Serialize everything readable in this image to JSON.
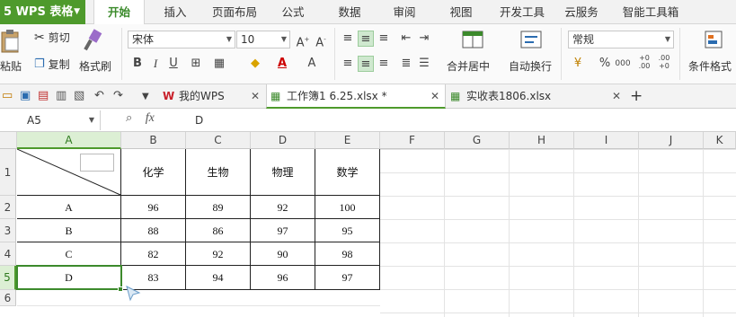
{
  "menubar": {
    "app_label": "5 WPS 表格",
    "tabs": [
      "开始",
      "插入",
      "页面布局",
      "公式",
      "数据",
      "审阅",
      "视图",
      "开发工具",
      "云服务",
      "智能工具箱"
    ],
    "active_tab": "开始"
  },
  "ribbon": {
    "paste_label": "粘贴",
    "cut_label": "剪切",
    "copy_label": "复制",
    "format_painter_label": "格式刷",
    "font_name": "宋体",
    "font_size": "10",
    "merge_center_label": "合并居中",
    "wrap_text_label": "自动换行",
    "number_format": "常规",
    "conditional_format_label": "条件格式",
    "percent_symbol": "%",
    "comma_symbol": "000"
  },
  "tabbar": {
    "tabs": [
      {
        "label": "我的WPS"
      },
      {
        "label": "工作簿1 6.25.xlsx *"
      },
      {
        "label": "实收表1806.xlsx"
      }
    ],
    "new_tab": "+"
  },
  "formulabar": {
    "name_box": "A5",
    "fx": "fx",
    "value": "D"
  },
  "grid": {
    "columns": [
      "A",
      "B",
      "C",
      "D",
      "E",
      "F",
      "G",
      "H",
      "I",
      "J",
      "K"
    ],
    "rows": [
      "1",
      "2",
      "3",
      "4",
      "5",
      "6"
    ],
    "selected_col": "A",
    "selected_row": "5",
    "table": {
      "header": [
        "化学",
        "生物",
        "物理",
        "数学"
      ],
      "rows": [
        {
          "label": "A",
          "values": [
            "96",
            "89",
            "92",
            "100"
          ]
        },
        {
          "label": "B",
          "values": [
            "88",
            "86",
            "97",
            "95"
          ]
        },
        {
          "label": "C",
          "values": [
            "82",
            "92",
            "90",
            "98"
          ]
        },
        {
          "label": "D",
          "values": [
            "83",
            "94",
            "96",
            "97"
          ]
        }
      ]
    }
  },
  "colors": {
    "brand_green": "#4e9a2c",
    "selection_green": "#3c8a2c"
  }
}
